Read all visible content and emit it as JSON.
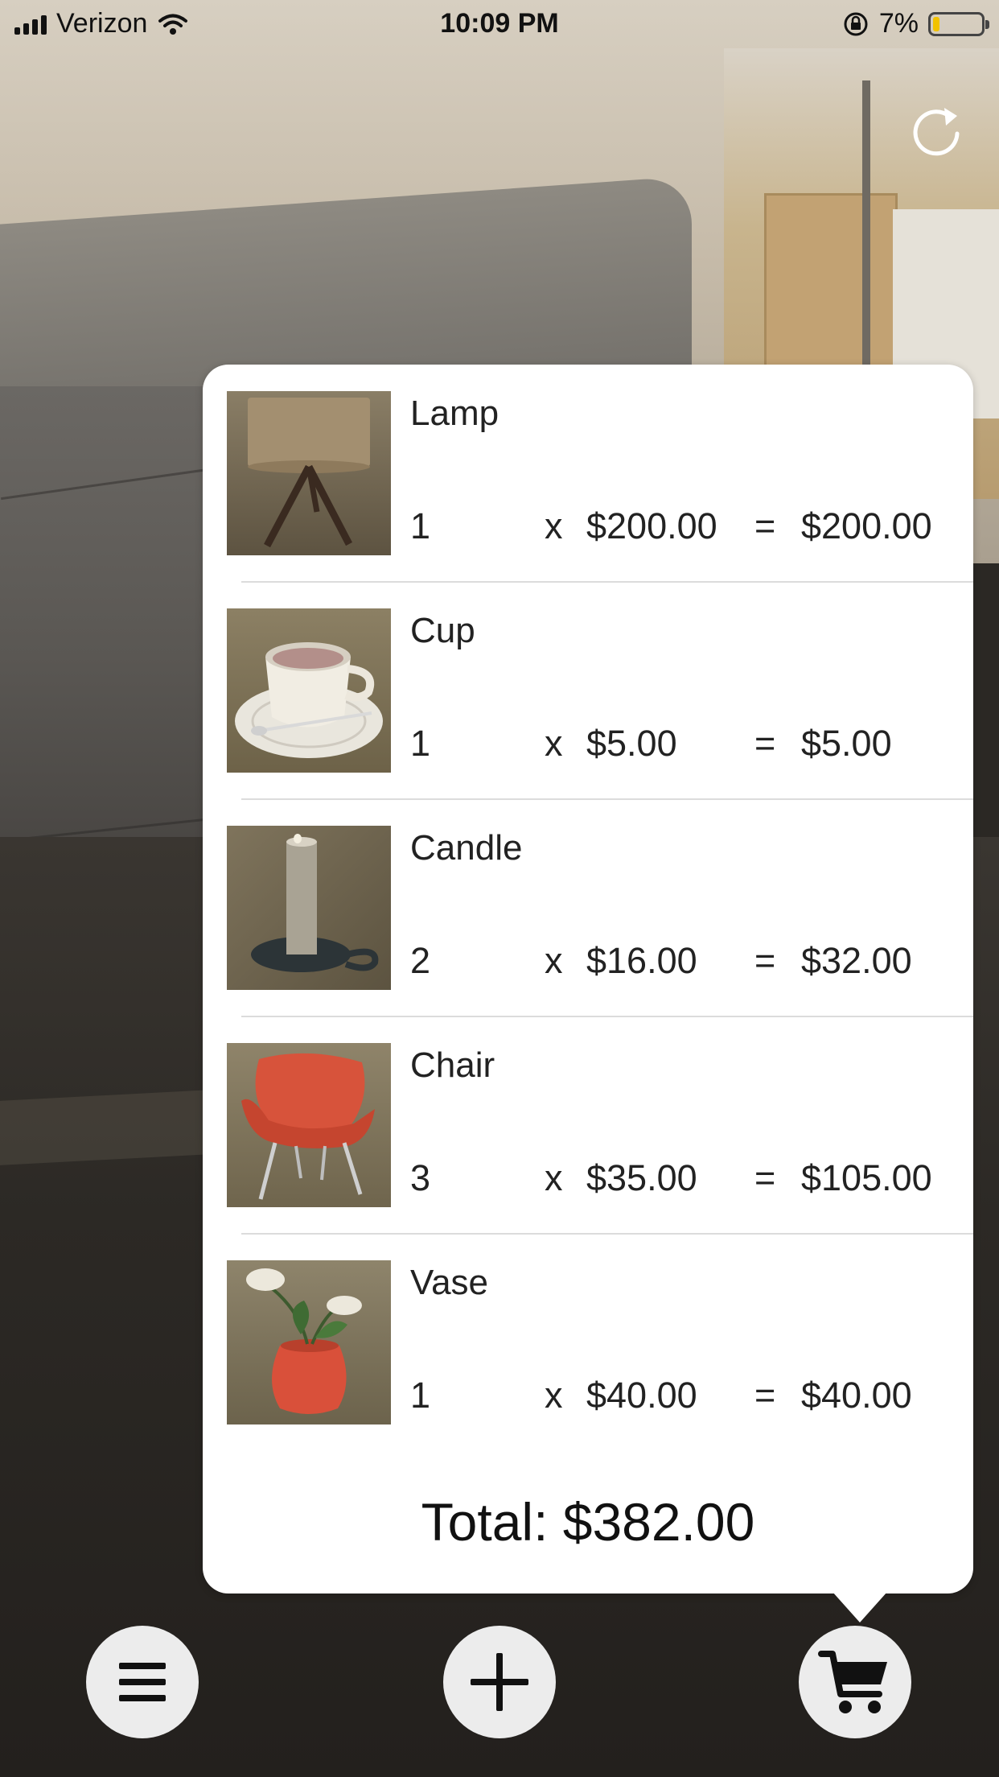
{
  "status_bar": {
    "carrier": "Verizon",
    "time": "10:09 PM",
    "battery_percent": "7%",
    "battery_level": 0.07
  },
  "icons": {
    "refresh": "refresh-icon",
    "menu": "hamburger-icon",
    "add": "plus-icon",
    "cart": "cart-icon"
  },
  "cart": {
    "items": [
      {
        "name": "Lamp",
        "qty": "1",
        "times": "x",
        "price": "$200.00",
        "eq": "=",
        "line_total": "$200.00"
      },
      {
        "name": "Cup",
        "qty": "1",
        "times": "x",
        "price": "$5.00",
        "eq": "=",
        "line_total": "$5.00"
      },
      {
        "name": "Candle",
        "qty": "2",
        "times": "x",
        "price": "$16.00",
        "eq": "=",
        "line_total": "$32.00"
      },
      {
        "name": "Chair",
        "qty": "3",
        "times": "x",
        "price": "$35.00",
        "eq": "=",
        "line_total": "$105.00"
      },
      {
        "name": "Vase",
        "qty": "1",
        "times": "x",
        "price": "$40.00",
        "eq": "=",
        "line_total": "$40.00"
      }
    ],
    "total_label": "Total: $382.00"
  },
  "colors": {
    "popover_bg": "#ffffff",
    "button_bg": "#ececec",
    "icon_dark": "#111111",
    "battery_low": "#f2c200"
  }
}
